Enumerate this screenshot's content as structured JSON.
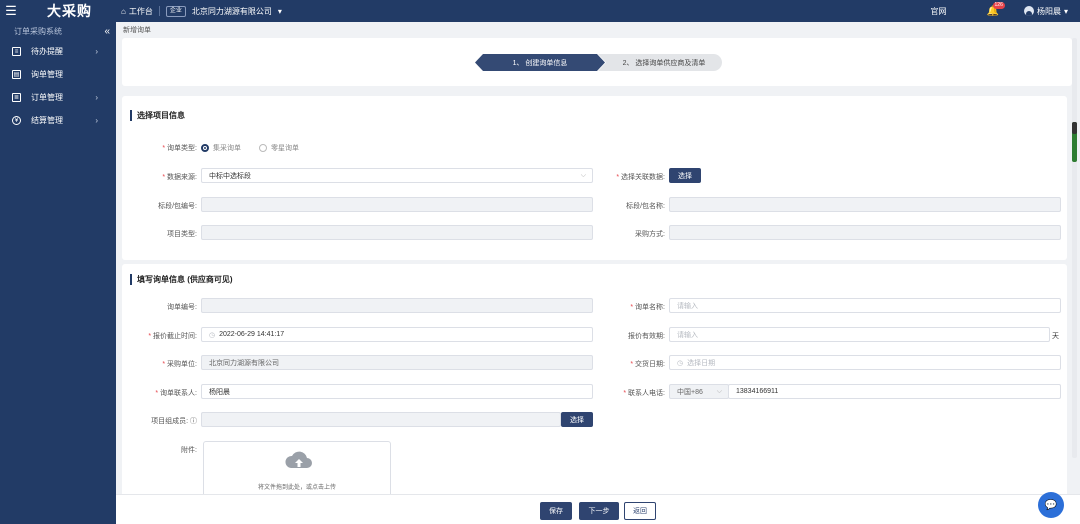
{
  "topbar": {
    "brand": "大采购",
    "workbench": "工作台",
    "enterprise_badge": "企业",
    "company": "北京同力湖源有限公司",
    "official_site": "官网",
    "notification_count": "126",
    "user_name": "杨阳晨"
  },
  "sidebar": {
    "system_title": "订单采购系统",
    "items": [
      {
        "label": "待办提醒",
        "icon": "list-icon",
        "has_children": true
      },
      {
        "label": "询单管理",
        "icon": "inquiry-icon",
        "has_children": false
      },
      {
        "label": "订单管理",
        "icon": "order-icon",
        "has_children": true
      },
      {
        "label": "结算管理",
        "icon": "settlement-icon",
        "has_children": true
      }
    ]
  },
  "breadcrumb": "新增询单",
  "steps": {
    "step1": "1、 创建询单信息",
    "step2": "2、 选择询单供应商及清单"
  },
  "section1": {
    "title": "选择项目信息",
    "inquiry_type_label": "询单类型:",
    "inquiry_type_options": [
      "集采询单",
      "零星询单"
    ],
    "data_source_label": "数据来源:",
    "data_source_value": "中标中选标段",
    "related_data_label": "选择关联数据:",
    "select_button": "选择",
    "section_no_label": "标段/包编号:",
    "section_name_label": "标段/包名称:",
    "project_type_label": "项目类型:",
    "purchase_method_label": "采购方式:"
  },
  "section2": {
    "title": "填写询单信息 (供应商可见)",
    "inquiry_no_label": "询单编号:",
    "inquiry_name_label": "询单名称:",
    "inquiry_name_placeholder": "请输入",
    "deadline_label": "报价截止时间:",
    "deadline_value": "2022-06-29 14:41:17",
    "validity_label": "报价有效期:",
    "validity_placeholder": "请输入",
    "validity_unit": "天",
    "purchaser_label": "采购单位:",
    "purchaser_value": "北京同力湖源有限公司",
    "delivery_date_label": "交货日期:",
    "delivery_date_placeholder": "选择日期",
    "contact_label": "询单联系人:",
    "contact_value": "杨阳晨",
    "phone_label": "联系人电话:",
    "phone_prefix": "中国+86",
    "phone_value": "13834166911",
    "members_label": "项目组成员:",
    "members_button": "选择",
    "attachment_label": "附件:",
    "upload_text": "将文件拖到此处，或点击上传"
  },
  "footer": {
    "save": "保存",
    "next": "下一步",
    "back": "返回"
  }
}
